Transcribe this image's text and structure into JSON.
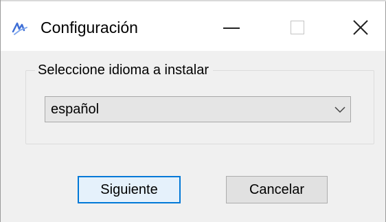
{
  "window": {
    "title": "Configuración"
  },
  "icons": {
    "app": "app-icon",
    "minimize": "minimize-icon",
    "maximize": "maximize-icon",
    "close": "close-icon",
    "dropdown": "chevron-down-icon"
  },
  "colors": {
    "focus_border": "#0078d7",
    "window_bg": "#f0f0f0",
    "titlebar_bg": "#ffffff",
    "app_icon": "#3f6fd6"
  },
  "language_group": {
    "label": "Seleccione idioma a instalar",
    "selected_language": "español"
  },
  "buttons": {
    "next_label": "Siguiente",
    "cancel_label": "Cancelar"
  }
}
